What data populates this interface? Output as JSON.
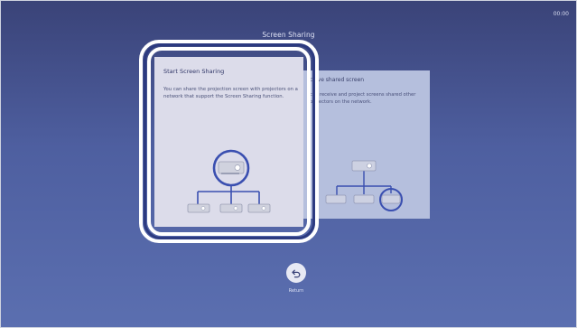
{
  "screen": {
    "title": "Screen Sharing",
    "clock": "00:00"
  },
  "cards": {
    "start": {
      "title": "Start Screen Sharing",
      "body": "You can share the projection screen with projectors on a network that support the Screen Sharing function."
    },
    "receive": {
      "title": "ceive shared screen",
      "body": "can receive and project screens shared other projectors on the network."
    }
  },
  "return": {
    "label": "Return",
    "icon": "return-arrow-icon"
  },
  "colors": {
    "background_top": "#3a4378",
    "background_bottom": "#5b6fb0",
    "accent_blue": "#3a4fb0",
    "card_selected": "#dcdcea",
    "card_unselected": "#b5bfdd"
  }
}
